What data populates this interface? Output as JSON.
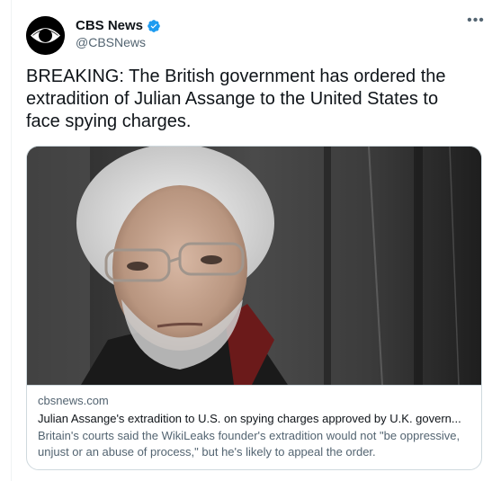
{
  "tweet": {
    "author": {
      "display_name": "CBS News",
      "handle": "@CBSNews",
      "verified": true,
      "avatar_icon": "cbs-eye-logo"
    },
    "more_label": "•••",
    "text": "BREAKING: The British government has ordered the extradition of Julian Assange to the United States to face spying charges.",
    "card": {
      "domain": "cbsnews.com",
      "title": "Julian Assange's extradition to U.S. on spying charges approved by U.K. govern...",
      "description": "Britain's courts said the WikiLeaks founder's extradition would not \"be oppressive, unjust or an abuse of process,\" but he's likely to appeal the order.",
      "image_icon": "article-photo"
    }
  },
  "colors": {
    "verified_blue": "#1d9bf0",
    "secondary_text": "#536471",
    "primary_text": "#0f1419",
    "border": "#cfd9de"
  }
}
